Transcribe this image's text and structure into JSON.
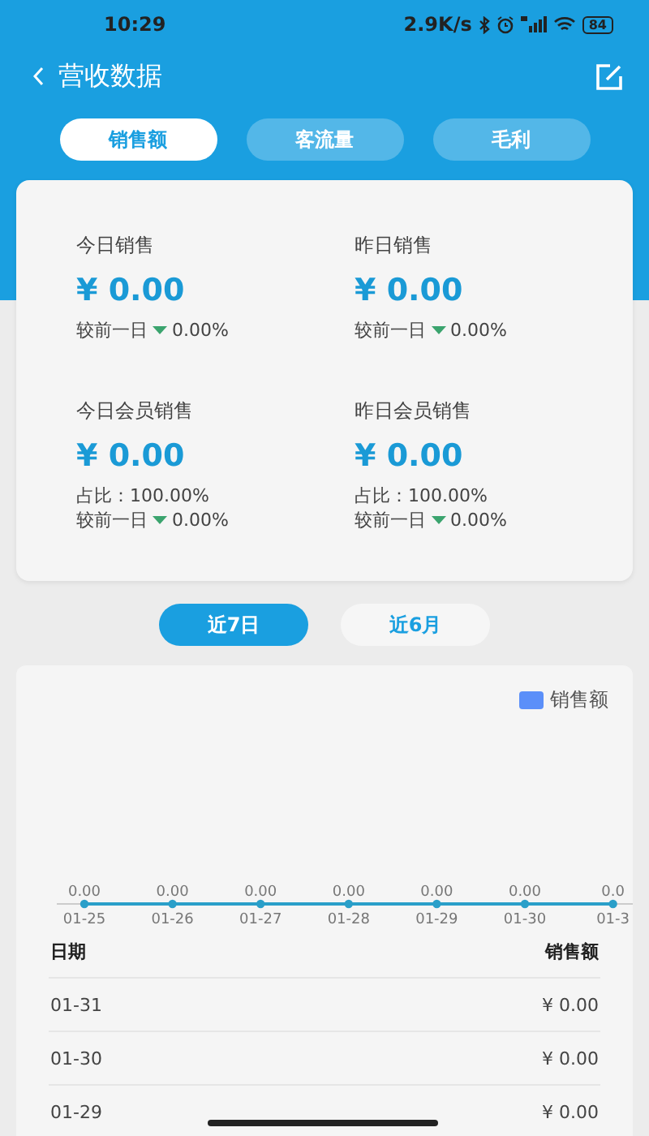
{
  "status_bar": {
    "time": "10:29",
    "speed": "2.9K/s",
    "battery": "84"
  },
  "header": {
    "title": "营收数据"
  },
  "tabs": [
    {
      "label": "销售额",
      "selected": true
    },
    {
      "label": "客流量",
      "selected": false
    },
    {
      "label": "毛利",
      "selected": false
    }
  ],
  "metrics": [
    {
      "label": "今日销售",
      "value": "¥ 0.00",
      "compare_label": "较前一日",
      "decreased": true,
      "change": "0.00%"
    },
    {
      "label": "昨日销售",
      "value": "¥ 0.00",
      "compare_label": "较前一日",
      "decreased": true,
      "change": "0.00%"
    },
    {
      "label": "今日会员销售",
      "value": "¥ 0.00",
      "share": "占比：100.00%",
      "compare_label": "较前一日",
      "decreased": true,
      "change": "0.00%"
    },
    {
      "label": "昨日会员销售",
      "value": "¥ 0.00",
      "share": "占比：100.00%",
      "compare_label": "较前一日",
      "decreased": true,
      "change": "0.00%"
    }
  ],
  "range_tabs": [
    {
      "label": "近7日",
      "selected": true
    },
    {
      "label": "近6月",
      "selected": false
    }
  ],
  "trend_chart": {
    "legend": "销售额",
    "points": [
      {
        "value_label": "0.00",
        "date": "01-25"
      },
      {
        "value_label": "0.00",
        "date": "01-26"
      },
      {
        "value_label": "0.00",
        "date": "01-27"
      },
      {
        "value_label": "0.00",
        "date": "01-28"
      },
      {
        "value_label": "0.00",
        "date": "01-29"
      },
      {
        "value_label": "0.00",
        "date": "01-30"
      },
      {
        "value_label": "0.0",
        "date": "01-3"
      }
    ]
  },
  "table": {
    "columns": [
      "日期",
      "销售额"
    ],
    "rows": [
      [
        "01-31",
        "¥ 0.00"
      ],
      [
        "01-30",
        "¥ 0.00"
      ],
      [
        "01-29",
        "¥ 0.00"
      ]
    ]
  }
}
